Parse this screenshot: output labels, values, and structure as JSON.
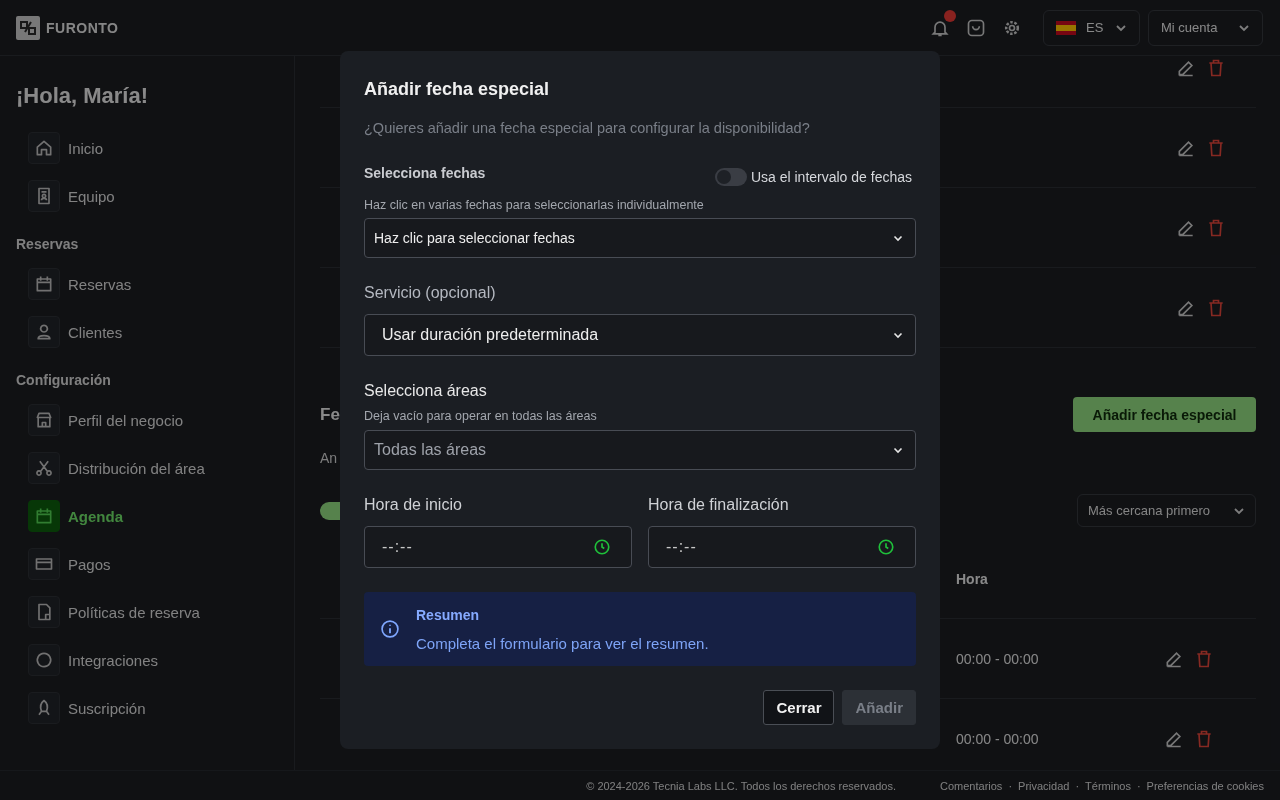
{
  "header": {
    "logo": "FURONTO",
    "notifications": {
      "unread": true
    },
    "language": "ES",
    "account": "Mi cuenta"
  },
  "sidebar": {
    "greeting": "¡Hola, María!",
    "groups": [
      {
        "items": [
          {
            "label": "Inicio",
            "selected": false
          },
          {
            "label": "Equipo",
            "selected": false
          }
        ]
      },
      {
        "title": "Reservas",
        "items": [
          {
            "label": "Reservas",
            "selected": false
          },
          {
            "label": "Clientes",
            "selected": false
          }
        ]
      },
      {
        "title": "Configuración",
        "items": [
          {
            "label": "Perfil del negocio",
            "selected": false
          },
          {
            "label": "Distribución del área",
            "selected": false
          },
          {
            "label": "Agenda",
            "selected": true
          },
          {
            "label": "Pagos",
            "selected": false
          },
          {
            "label": "Políticas de reserva",
            "selected": false
          },
          {
            "label": "Integraciones",
            "selected": false
          },
          {
            "label": "Suscripción",
            "selected": false
          }
        ]
      }
    ]
  },
  "main": {
    "upper_rows": [
      {
        "editable": true,
        "deletable": true
      },
      {
        "editable": true,
        "deletable": true
      },
      {
        "editable": true,
        "deletable": true
      },
      {
        "editable": true,
        "deletable": true
      }
    ],
    "section_title": "Fe",
    "section_subtitle": "An",
    "add_button": "Añadir fecha especial",
    "toggle": {
      "on": true
    },
    "sort": "Más cercana primero",
    "table": {
      "columns": [
        "Hora"
      ],
      "rows": [
        {
          "cells": [
            "00:00 - 00:00"
          ]
        },
        {
          "cells": [
            "00:00 - 00:00"
          ]
        }
      ]
    }
  },
  "footer": {
    "copyright": "© 2024-2026 Tecnia Labs LLC. Todos los derechos reservados.",
    "separator": "·",
    "links": [
      "Comentarios",
      "Privacidad",
      "Términos",
      "Preferencias de cookies"
    ]
  },
  "dialog": {
    "title": "Añadir fecha especial",
    "subtitle": "¿Quieres añadir una fecha especial para configurar la disponibilidad?",
    "dates": {
      "label": "Selecciona fechas",
      "range_toggle": {
        "label": "Usa el intervalo de fechas",
        "on": false
      },
      "hint": "Haz clic en varias fechas para seleccionarlas individualmente",
      "value": "Haz clic para seleccionar fechas"
    },
    "service": {
      "label": "Servicio (opcional)",
      "value": "Usar duración predeterminada"
    },
    "areas": {
      "label": "Selecciona áreas",
      "hint": "Deja vacío para operar en todas las áreas",
      "placeholder": "Todas las áreas"
    },
    "times": [
      {
        "label": "Hora de inicio",
        "placeholder": "--:--"
      },
      {
        "label": "Hora de finalización",
        "placeholder": "--:--"
      }
    ],
    "summary": {
      "title": "Resumen",
      "text": "Completa el formulario para ver el resumen."
    },
    "buttons": [
      {
        "label": "Cerrar",
        "disabled": false
      },
      {
        "label": "Añadir",
        "disabled": true
      }
    ]
  }
}
